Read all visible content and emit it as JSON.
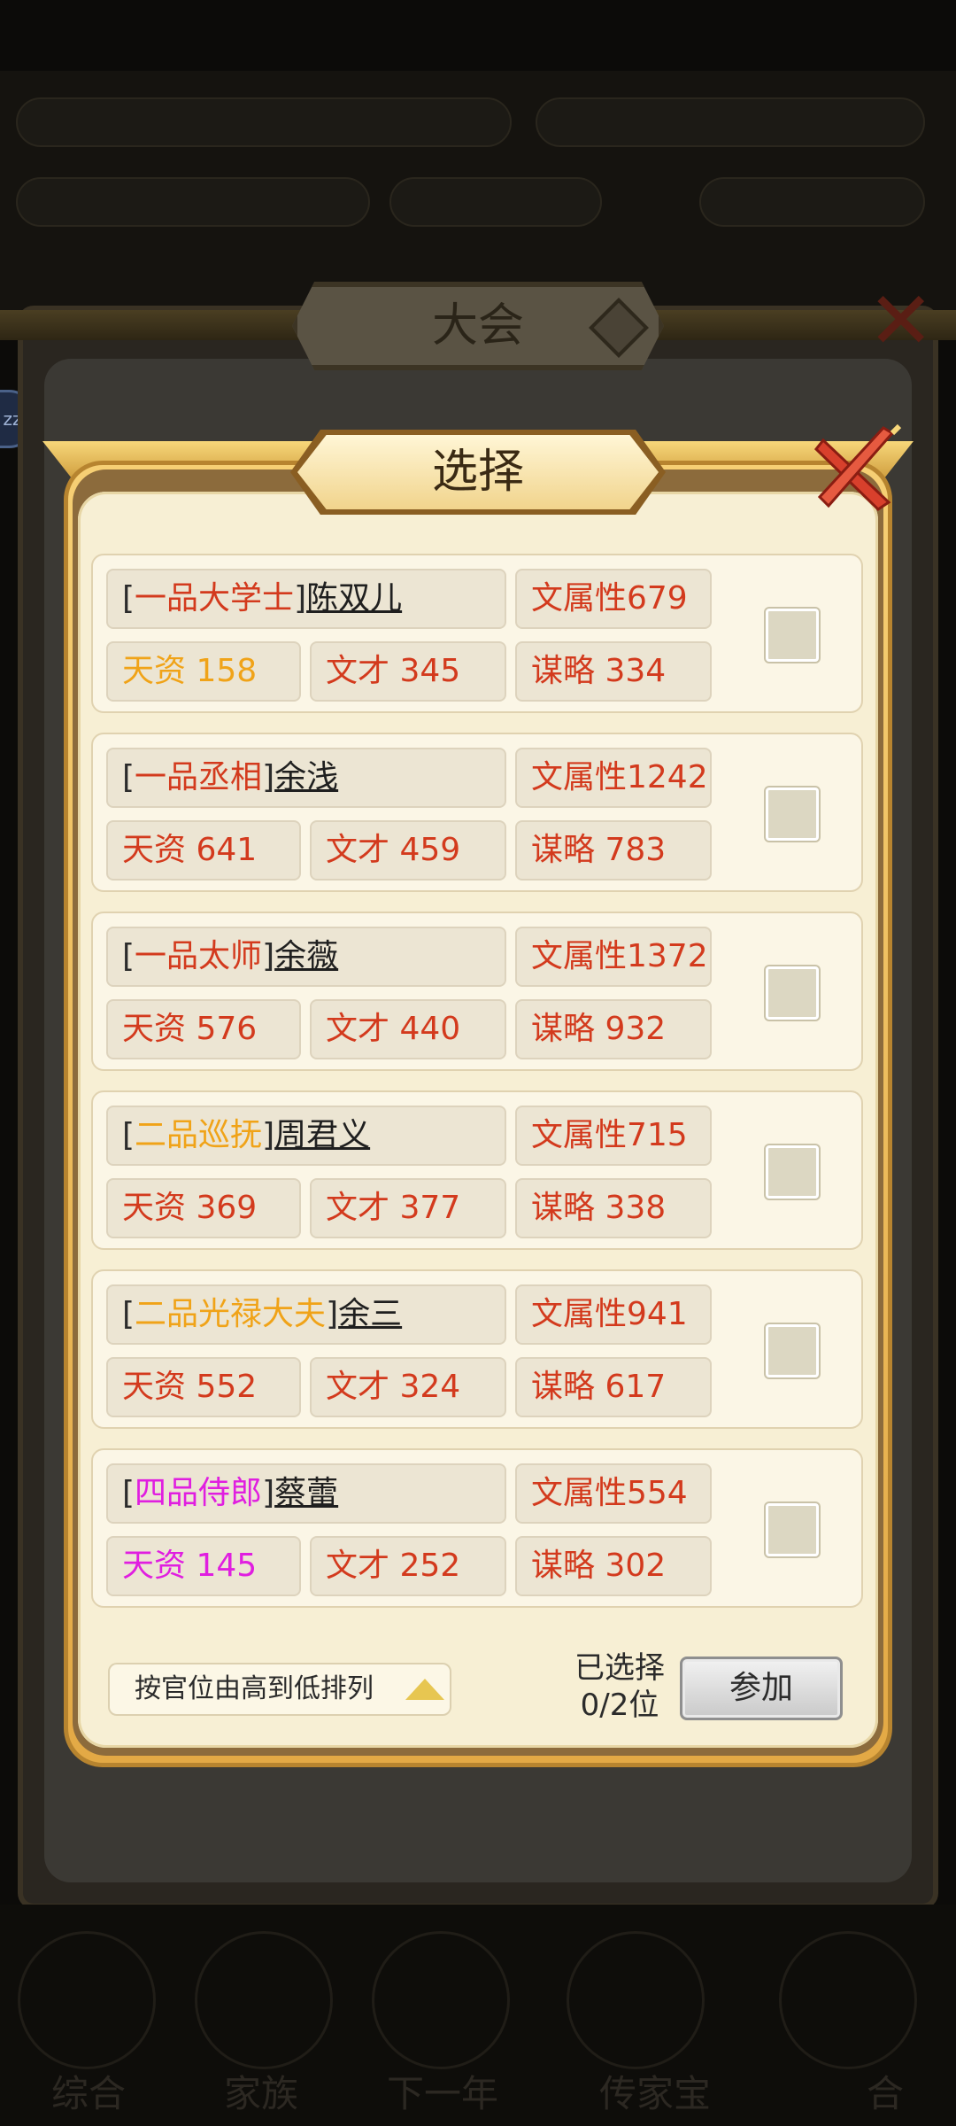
{
  "background": {
    "nav_items": [
      "综合",
      "家族",
      "下一年",
      "传家宝",
      "合"
    ]
  },
  "outer_panel": {
    "title": "大会"
  },
  "dialog": {
    "title": "选择",
    "candidates": [
      {
        "rank": "一品大学士",
        "rank_color": "#d33a1d",
        "name": "陈双儿",
        "attr": "文属性679",
        "tianzi": "天资 158",
        "tianzi_color": "#f0a318",
        "wencai": "文才 345",
        "moulue": "谋略 334"
      },
      {
        "rank": "一品丞相",
        "rank_color": "#d33a1d",
        "name": "余浅",
        "attr": "文属性1242",
        "tianzi": "天资 641",
        "tianzi_color": "#d33a1d",
        "wencai": "文才 459",
        "moulue": "谋略 783"
      },
      {
        "rank": "一品太师",
        "rank_color": "#d33a1d",
        "name": "余薇",
        "attr": "文属性1372",
        "tianzi": "天资 576",
        "tianzi_color": "#d33a1d",
        "wencai": "文才 440",
        "moulue": "谋略 932"
      },
      {
        "rank": "二品巡抚",
        "rank_color": "#f0a318",
        "name": "周君义",
        "attr": "文属性715",
        "tianzi": "天资 369",
        "tianzi_color": "#d33a1d",
        "wencai": "文才 377",
        "moulue": "谋略 338"
      },
      {
        "rank": "二品光禄大夫",
        "rank_color": "#f0a318",
        "name": "余三",
        "attr": "文属性941",
        "tianzi": "天资 552",
        "tianzi_color": "#d33a1d",
        "wencai": "文才 324",
        "moulue": "谋略 617"
      },
      {
        "rank": "四品侍郎",
        "rank_color": "#e01ee0",
        "name": "蔡蕾",
        "attr": "文属性554",
        "tianzi": "天资 145",
        "tianzi_color": "#e01ee0",
        "wencai": "文才 252",
        "moulue": "谋略 302"
      }
    ],
    "sort_label": "按官位由高到低排列",
    "selected_label_1": "已选择",
    "selected_label_2": "0/2位",
    "join_label": "参加"
  }
}
